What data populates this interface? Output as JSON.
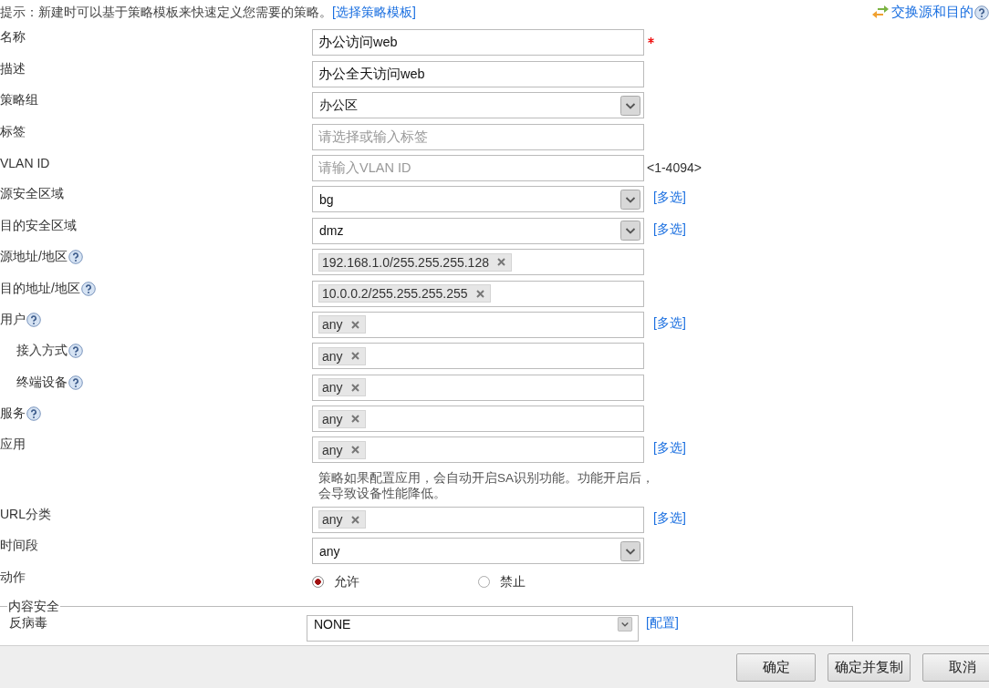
{
  "hint": {
    "text": "提示：新建时可以基于策略模板来快速定义您需要的策略。",
    "link": "[选择策略模板]"
  },
  "swap_link": {
    "label": "交换源和目的"
  },
  "fields": [
    {
      "label": "名称",
      "kind": "text",
      "value": "办公访问web",
      "help": false,
      "indent": false,
      "required": true
    },
    {
      "label": "描述",
      "kind": "text",
      "value": "办公全天访问web",
      "help": false,
      "indent": false
    },
    {
      "label": "策略组",
      "kind": "select",
      "value": "办公区",
      "help": false,
      "indent": false
    },
    {
      "label": "标签",
      "kind": "text",
      "placeholder": "请选择或输入标签",
      "help": false,
      "indent": false
    },
    {
      "label": "VLAN ID",
      "kind": "text",
      "placeholder": "请输入VLAN ID",
      "help": false,
      "indent": false,
      "suffix": "<1-4094>"
    },
    {
      "label": "源安全区域",
      "kind": "select",
      "value": "bg",
      "help": false,
      "indent": false,
      "link": "[多选]"
    },
    {
      "label": "目的安全区域",
      "kind": "select",
      "value": "dmz",
      "help": false,
      "indent": false,
      "link": "[多选]"
    },
    {
      "label": "源地址/地区",
      "kind": "tags",
      "tags": [
        "192.168.1.0/255.255.255.128"
      ],
      "help": true,
      "indent": false
    },
    {
      "label": "目的地址/地区",
      "kind": "tags",
      "tags": [
        "10.0.0.2/255.255.255.255"
      ],
      "help": true,
      "indent": false
    },
    {
      "label": "用户",
      "kind": "tags",
      "tags": [
        "any"
      ],
      "help": true,
      "indent": false,
      "link": "[多选]"
    },
    {
      "label": "接入方式",
      "kind": "tags",
      "tags": [
        "any"
      ],
      "help": true,
      "indent": true
    },
    {
      "label": "终端设备",
      "kind": "tags",
      "tags": [
        "any"
      ],
      "help": true,
      "indent": true
    },
    {
      "label": "服务",
      "kind": "tags",
      "tags": [
        "any"
      ],
      "help": true,
      "indent": false
    },
    {
      "label": "应用",
      "kind": "tags",
      "tags": [
        "any"
      ],
      "help": false,
      "indent": false,
      "link": "[多选]",
      "note": "策略如果配置应用，会自动开启SA识别功能。功能开启后，会导致设备性能降低。"
    },
    {
      "label": "URL分类",
      "kind": "tags",
      "tags": [
        "any"
      ],
      "help": false,
      "indent": false,
      "link": "[多选]"
    },
    {
      "label": "时间段",
      "kind": "select",
      "value": "any",
      "help": false,
      "indent": false
    },
    {
      "label": "动作",
      "kind": "radio",
      "help": false,
      "indent": false,
      "options": [
        {
          "label": "允许",
          "selected": true
        },
        {
          "label": "禁止",
          "selected": false
        }
      ]
    }
  ],
  "content_security": {
    "legend": "内容安全",
    "rows": [
      {
        "label": "反病毒",
        "kind": "select",
        "value": "NONE",
        "link": "[配置]"
      }
    ]
  },
  "buttons": [
    {
      "label": "确定"
    },
    {
      "label": "确定并复制"
    },
    {
      "label": "取消"
    }
  ]
}
